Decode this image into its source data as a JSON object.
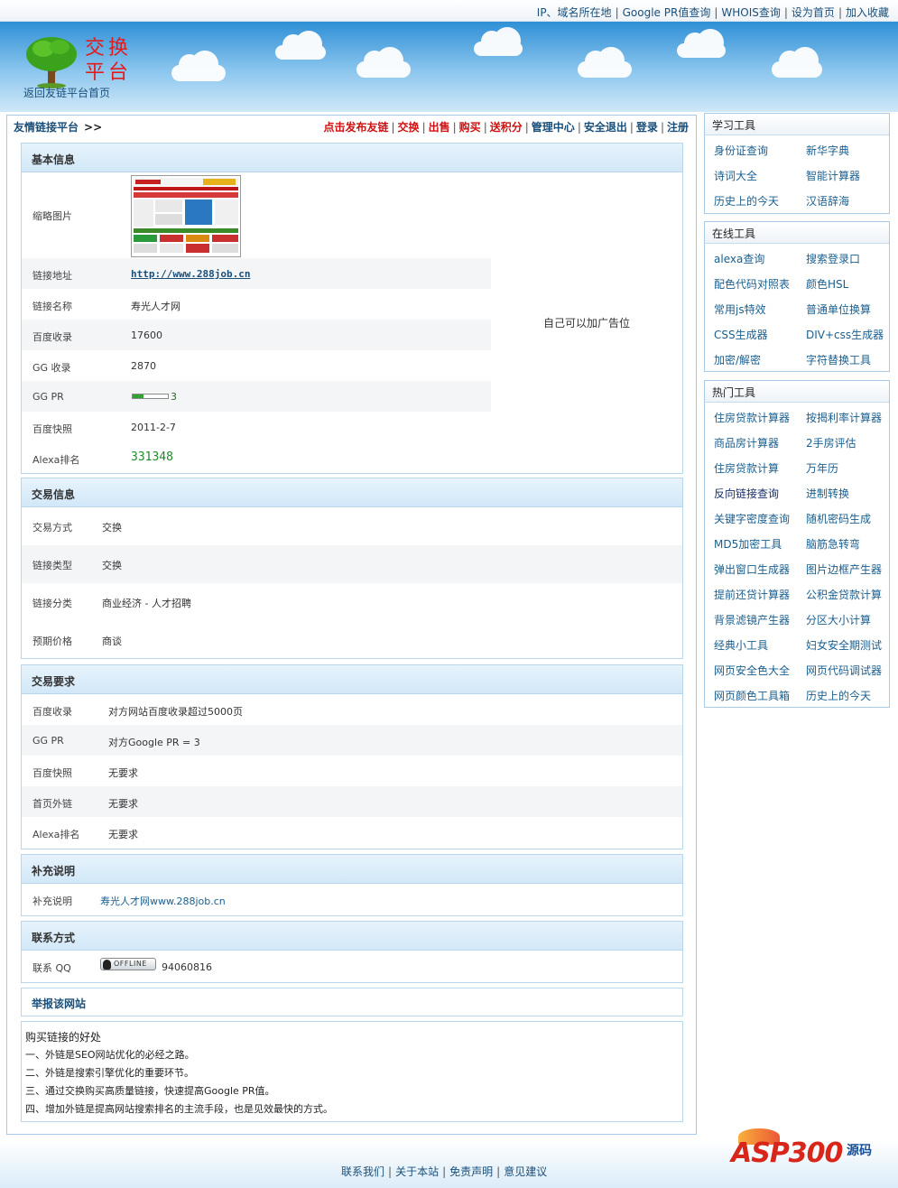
{
  "top_links": [
    "IP、域名所在地",
    "Google PR值查询",
    "WHOIS查询",
    "设为首页",
    "加入收藏"
  ],
  "header": {
    "logo_text_line1": "交换",
    "logo_text_line2": "平台",
    "home_link": "返回友链平台首页"
  },
  "nav": {
    "brand": "友情链接平台",
    "brand_arrow": ">>",
    "links": [
      {
        "label": "点击发布友链",
        "color": "red"
      },
      {
        "label": "交换",
        "color": "red"
      },
      {
        "label": "出售",
        "color": "red"
      },
      {
        "label": "购买",
        "color": "red"
      },
      {
        "label": "送积分",
        "color": "red"
      },
      {
        "label": "管理中心",
        "color": "blue"
      },
      {
        "label": "安全退出",
        "color": "blue"
      },
      {
        "label": "登录",
        "color": "blue"
      },
      {
        "label": "注册",
        "color": "blue"
      }
    ]
  },
  "basic_info": {
    "title": "基本信息",
    "thumbnail_label": "缩略图片",
    "ad_text": "自己可以加广告位",
    "rows": [
      {
        "label": "链接地址",
        "value": "http://www.288job.cn"
      },
      {
        "label": "链接名称",
        "value": "寿光人才网"
      },
      {
        "label": "百度收录",
        "value": "17600"
      },
      {
        "label": "GG 收录",
        "value": "2870"
      },
      {
        "label": "GG  PR",
        "value": "3"
      },
      {
        "label": "百度快照",
        "value": "2011-2-7"
      },
      {
        "label": "Alexa排名",
        "value": "331348"
      }
    ],
    "pr_fraction": 0.3
  },
  "trade_info": {
    "title": "交易信息",
    "rows": [
      {
        "label": "交易方式",
        "value": "交换"
      },
      {
        "label": "链接类型",
        "value": "交换"
      },
      {
        "label": "链接分类",
        "value": "商业经济 - 人才招聘"
      },
      {
        "label": "预期价格",
        "value": "商谈"
      }
    ]
  },
  "trade_req": {
    "title": "交易要求",
    "rows": [
      {
        "label": "百度收录",
        "value": "对方网站百度收录超过5000页"
      },
      {
        "label": "GG  PR",
        "value": "对方Google PR = 3"
      },
      {
        "label": "百度快照",
        "value": "无要求"
      },
      {
        "label": "首页外链",
        "value": "无要求"
      },
      {
        "label": "Alexa排名",
        "value": "无要求"
      }
    ]
  },
  "supplement": {
    "title": "补充说明",
    "label": "补充说明",
    "value_a": "寿光人才网",
    "value_b": "www.288job.cn"
  },
  "contact": {
    "title": "联系方式",
    "label": "联系 QQ",
    "qq_badge": "OFFLINE",
    "qq": "94060816"
  },
  "report": {
    "title": "举报该网站"
  },
  "benefits": {
    "title": "购买链接的好处",
    "items": [
      "一、外链是SEO网站优化的必经之路。",
      "二、外链是搜索引擎优化的重要环节。",
      "三、通过交换购买高质量链接，快速提高Google PR值。",
      "四、增加外链是提高网站搜索排名的主流手段，也是见效最快的方式。"
    ]
  },
  "sidebar": {
    "study": {
      "title": "学习工具",
      "items": [
        "身份证查询",
        "新华字典",
        "诗词大全",
        "智能计算器",
        "历史上的今天",
        "汉语辞海"
      ]
    },
    "online": {
      "title": "在线工具",
      "items": [
        "alexa查询",
        "搜索登录口",
        "配色代码对照表",
        "颜色HSL",
        "常用js特效",
        "普通单位换算",
        "CSS生成器",
        "DIV+css生成器",
        "加密/解密",
        "字符替换工具"
      ]
    },
    "hot": {
      "title": "热门工具",
      "items": [
        "住房贷款计算器",
        "按揭利率计算器",
        "商品房计算器",
        "2手房评估",
        "住房贷款计算",
        "万年历",
        "反向链接查询",
        "进制转换",
        "关键字密度查询",
        "随机密码生成",
        "MD5加密工具",
        "脑筋急转弯",
        "弹出窗口生成器",
        "图片边框产生器",
        "提前还贷计算器",
        "公积金贷款计算",
        "背景滤镜产生器",
        "分区大小计算",
        "经典小工具",
        "妇女安全期测试",
        "网页安全色大全",
        "网页代码调试器",
        "网页颜色工具箱",
        "历史上的今天"
      ]
    }
  },
  "footer": {
    "links": [
      "联系我们",
      "关于本站",
      "免责声明",
      "意见建议"
    ],
    "logo_text": "ASP300",
    "logo_sub": "源码"
  }
}
